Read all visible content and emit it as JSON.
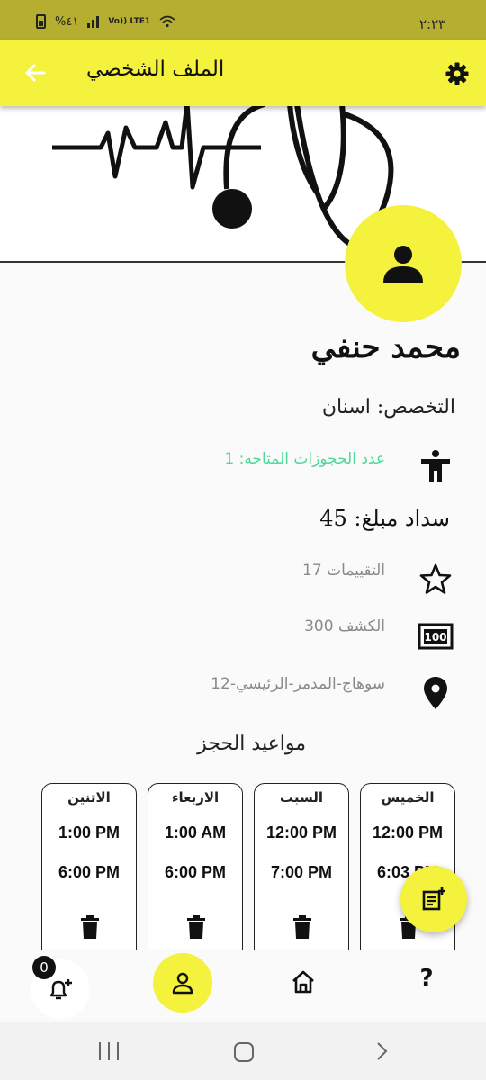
{
  "status_bar": {
    "time": "٢:٢٣",
    "battery": "%٤١",
    "network": "Vo)) LTE1"
  },
  "app_bar": {
    "title": "الملف الشخصي",
    "back_icon": "arrow-back-icon",
    "settings_icon": "gear-icon",
    "color": "#f4f23c"
  },
  "profile": {
    "name": "محمد   حنفي",
    "specialty": "التخصص: اسنان",
    "available_bookings": "عدد الحجوزات المتاحه: 1",
    "payment": "سداد مبلغ: 45",
    "ratings": "التقييمات 17",
    "fee": "الكشف 300",
    "address": "سوهاج-المدمر-الرئيسي-12"
  },
  "schedule": {
    "title": "مواعيد الحجز",
    "days": [
      {
        "day": "الخميس",
        "start": "12:00 PM",
        "end": "6:03 PM"
      },
      {
        "day": "السبت",
        "start": "12:00 PM",
        "end": "7:00 PM"
      },
      {
        "day": "الاربعاء",
        "start": "1:00 AM",
        "end": "6:00 PM"
      },
      {
        "day": "الاتنين",
        "start": "1:00 PM",
        "end": "6:00 PM"
      }
    ]
  },
  "bottom_nav": {
    "notification_count": "0",
    "help_label": "?"
  },
  "colors": {
    "accent": "#f4f23c",
    "status_bar": "#b6ae30",
    "available_text": "#4fd89a",
    "muted_text": "#8a8a8a"
  }
}
